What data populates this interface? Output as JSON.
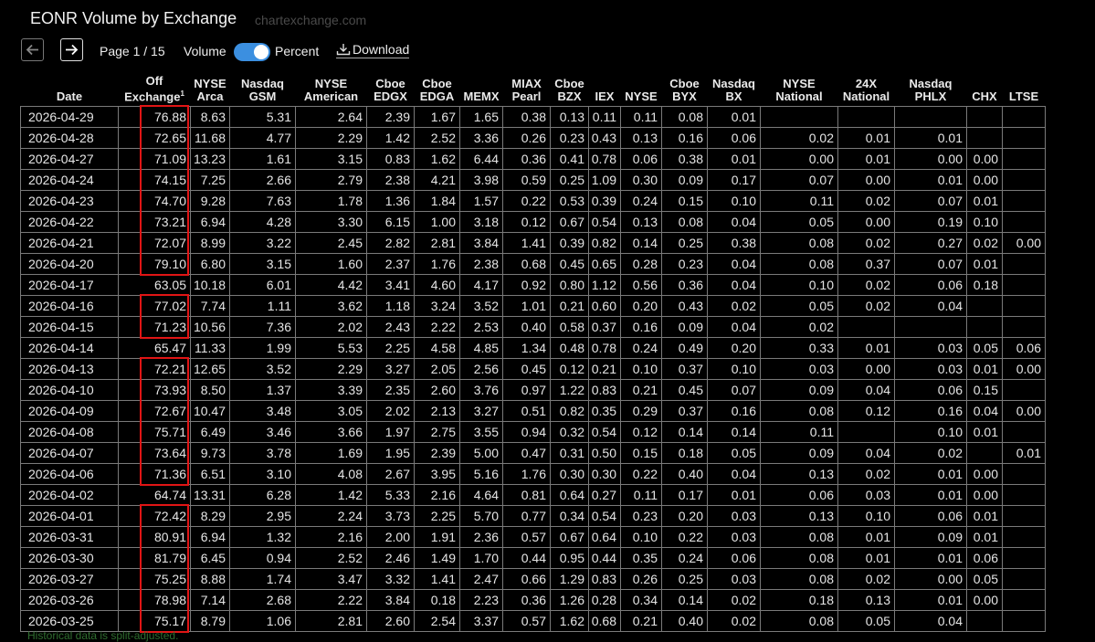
{
  "header": {
    "title": "EONR Volume by Exchange",
    "watermark": "chartexchange.com"
  },
  "toolbar": {
    "page_label": "Page 1 / 15",
    "volume_label": "Volume",
    "percent_label": "Percent",
    "download_label": "Download",
    "toggle_state": "percent"
  },
  "icons": {
    "prev": "arrow-left-icon",
    "next": "arrow-right-icon",
    "download": "download-icon"
  },
  "colors": {
    "toggle": "#3b8fe0",
    "highlight": "#e01515"
  },
  "columns": [
    [
      "",
      "Date"
    ],
    [
      "Off",
      "Exchange"
    ],
    [
      "NYSE",
      "Arca"
    ],
    [
      "Nasdaq",
      "GSM"
    ],
    [
      "NYSE",
      "American"
    ],
    [
      "Cboe",
      "EDGX"
    ],
    [
      "Cboe",
      "EDGA"
    ],
    [
      "",
      "MEMX"
    ],
    [
      "MIAX",
      "Pearl"
    ],
    [
      "Cboe",
      "BZX"
    ],
    [
      "",
      "IEX"
    ],
    [
      "",
      "NYSE"
    ],
    [
      "Cboe",
      "BYX"
    ],
    [
      "Nasdaq",
      "BX"
    ],
    [
      "NYSE",
      "National"
    ],
    [
      "24X",
      "National"
    ],
    [
      "Nasdaq",
      "PHLX"
    ],
    [
      "",
      "CHX"
    ],
    [
      "",
      "LTSE"
    ]
  ],
  "off_exchange_sup": "1",
  "rows": [
    [
      "2026-04-29",
      "76.88",
      "8.63",
      "5.31",
      "2.64",
      "2.39",
      "1.67",
      "1.65",
      "0.38",
      "0.13",
      "0.11",
      "0.11",
      "0.08",
      "0.01",
      "",
      "",
      "",
      "",
      ""
    ],
    [
      "2026-04-28",
      "72.65",
      "11.68",
      "4.77",
      "2.29",
      "1.42",
      "2.52",
      "3.36",
      "0.26",
      "0.23",
      "0.43",
      "0.13",
      "0.16",
      "0.06",
      "0.02",
      "0.01",
      "0.01",
      "",
      ""
    ],
    [
      "2026-04-27",
      "71.09",
      "13.23",
      "1.61",
      "3.15",
      "0.83",
      "1.62",
      "6.44",
      "0.36",
      "0.41",
      "0.78",
      "0.06",
      "0.38",
      "0.01",
      "0.00",
      "0.01",
      "0.00",
      "0.00",
      ""
    ],
    [
      "2026-04-24",
      "74.15",
      "7.25",
      "2.66",
      "2.79",
      "2.38",
      "4.21",
      "3.98",
      "0.59",
      "0.25",
      "1.09",
      "0.30",
      "0.09",
      "0.17",
      "0.07",
      "0.00",
      "0.01",
      "0.00",
      ""
    ],
    [
      "2026-04-23",
      "74.70",
      "9.28",
      "7.63",
      "1.78",
      "1.36",
      "1.84",
      "1.57",
      "0.22",
      "0.53",
      "0.39",
      "0.24",
      "0.15",
      "0.10",
      "0.11",
      "0.02",
      "0.07",
      "0.01",
      ""
    ],
    [
      "2026-04-22",
      "73.21",
      "6.94",
      "4.28",
      "3.30",
      "6.15",
      "1.00",
      "3.18",
      "0.12",
      "0.67",
      "0.54",
      "0.13",
      "0.08",
      "0.04",
      "0.05",
      "0.00",
      "0.19",
      "0.10",
      ""
    ],
    [
      "2026-04-21",
      "72.07",
      "8.99",
      "3.22",
      "2.45",
      "2.82",
      "2.81",
      "3.84",
      "1.41",
      "0.39",
      "0.82",
      "0.14",
      "0.25",
      "0.38",
      "0.08",
      "0.02",
      "0.27",
      "0.02",
      "0.00"
    ],
    [
      "2026-04-20",
      "79.10",
      "6.80",
      "3.15",
      "1.60",
      "2.37",
      "1.76",
      "2.38",
      "0.68",
      "0.45",
      "0.65",
      "0.28",
      "0.23",
      "0.04",
      "0.08",
      "0.37",
      "0.07",
      "0.01",
      ""
    ],
    [
      "2026-04-17",
      "63.05",
      "10.18",
      "6.01",
      "4.42",
      "3.41",
      "4.60",
      "4.17",
      "0.92",
      "0.80",
      "1.12",
      "0.56",
      "0.36",
      "0.04",
      "0.10",
      "0.02",
      "0.06",
      "0.18",
      ""
    ],
    [
      "2026-04-16",
      "77.02",
      "7.74",
      "1.11",
      "3.62",
      "1.18",
      "3.24",
      "3.52",
      "1.01",
      "0.21",
      "0.60",
      "0.20",
      "0.43",
      "0.02",
      "0.05",
      "0.02",
      "0.04",
      "",
      ""
    ],
    [
      "2026-04-15",
      "71.23",
      "10.56",
      "7.36",
      "2.02",
      "2.43",
      "2.22",
      "2.53",
      "0.40",
      "0.58",
      "0.37",
      "0.16",
      "0.09",
      "0.04",
      "0.02",
      "",
      "",
      "",
      ""
    ],
    [
      "2026-04-14",
      "65.47",
      "11.33",
      "1.99",
      "5.53",
      "2.25",
      "4.58",
      "4.85",
      "1.34",
      "0.48",
      "0.78",
      "0.24",
      "0.49",
      "0.20",
      "0.33",
      "0.01",
      "0.03",
      "0.05",
      "0.06"
    ],
    [
      "2026-04-13",
      "72.21",
      "12.65",
      "3.52",
      "2.29",
      "3.27",
      "2.05",
      "2.56",
      "0.45",
      "0.12",
      "0.21",
      "0.10",
      "0.37",
      "0.10",
      "0.03",
      "0.00",
      "0.03",
      "0.01",
      "0.00"
    ],
    [
      "2026-04-10",
      "73.93",
      "8.50",
      "1.37",
      "3.39",
      "2.35",
      "2.60",
      "3.76",
      "0.97",
      "1.22",
      "0.83",
      "0.21",
      "0.45",
      "0.07",
      "0.09",
      "0.04",
      "0.06",
      "0.15",
      ""
    ],
    [
      "2026-04-09",
      "72.67",
      "10.47",
      "3.48",
      "3.05",
      "2.02",
      "2.13",
      "3.27",
      "0.51",
      "0.82",
      "0.35",
      "0.29",
      "0.37",
      "0.16",
      "0.08",
      "0.12",
      "0.16",
      "0.04",
      "0.00"
    ],
    [
      "2026-04-08",
      "75.71",
      "6.49",
      "3.46",
      "3.66",
      "1.97",
      "2.75",
      "3.55",
      "0.94",
      "0.32",
      "0.54",
      "0.12",
      "0.14",
      "0.14",
      "0.11",
      "",
      "0.10",
      "0.01",
      ""
    ],
    [
      "2026-04-07",
      "73.64",
      "9.73",
      "3.78",
      "1.69",
      "1.95",
      "2.39",
      "5.00",
      "0.47",
      "0.31",
      "0.50",
      "0.15",
      "0.18",
      "0.05",
      "0.09",
      "0.04",
      "0.02",
      "",
      "0.01"
    ],
    [
      "2026-04-06",
      "71.36",
      "6.51",
      "3.10",
      "4.08",
      "2.67",
      "3.95",
      "5.16",
      "1.76",
      "0.30",
      "0.30",
      "0.22",
      "0.40",
      "0.04",
      "0.13",
      "0.02",
      "0.01",
      "0.00",
      ""
    ],
    [
      "2026-04-02",
      "64.74",
      "13.31",
      "6.28",
      "1.42",
      "5.33",
      "2.16",
      "4.64",
      "0.81",
      "0.64",
      "0.27",
      "0.11",
      "0.17",
      "0.01",
      "0.06",
      "0.03",
      "0.01",
      "0.00",
      ""
    ],
    [
      "2026-04-01",
      "72.42",
      "8.29",
      "2.95",
      "2.24",
      "3.73",
      "2.25",
      "5.70",
      "0.77",
      "0.34",
      "0.54",
      "0.23",
      "0.20",
      "0.03",
      "0.13",
      "0.10",
      "0.06",
      "0.01",
      ""
    ],
    [
      "2026-03-31",
      "80.91",
      "6.94",
      "1.32",
      "2.16",
      "2.00",
      "1.91",
      "2.36",
      "0.57",
      "0.67",
      "0.64",
      "0.10",
      "0.22",
      "0.03",
      "0.08",
      "0.01",
      "0.09",
      "0.01",
      ""
    ],
    [
      "2026-03-30",
      "81.79",
      "6.45",
      "0.94",
      "2.52",
      "2.46",
      "1.49",
      "1.70",
      "0.44",
      "0.95",
      "0.44",
      "0.35",
      "0.24",
      "0.06",
      "0.08",
      "0.01",
      "0.01",
      "0.06",
      ""
    ],
    [
      "2026-03-27",
      "75.25",
      "8.88",
      "1.74",
      "3.47",
      "3.32",
      "1.41",
      "2.47",
      "0.66",
      "1.29",
      "0.83",
      "0.26",
      "0.25",
      "0.03",
      "0.08",
      "0.02",
      "0.00",
      "0.05",
      ""
    ],
    [
      "2026-03-26",
      "78.98",
      "7.14",
      "2.68",
      "2.22",
      "3.84",
      "0.18",
      "2.23",
      "0.36",
      "1.26",
      "0.28",
      "0.34",
      "0.14",
      "0.02",
      "0.18",
      "0.13",
      "0.01",
      "0.00",
      ""
    ],
    [
      "2026-03-25",
      "75.17",
      "8.79",
      "1.06",
      "2.81",
      "2.60",
      "2.54",
      "3.37",
      "0.57",
      "1.62",
      "0.68",
      "0.21",
      "0.40",
      "0.02",
      "0.08",
      "0.05",
      "0.04",
      "",
      ""
    ]
  ],
  "highlight_groups": [
    [
      0,
      7
    ],
    [
      9,
      10
    ],
    [
      12,
      17
    ],
    [
      19,
      24
    ]
  ],
  "footnote": "Historical data is split-adjusted."
}
